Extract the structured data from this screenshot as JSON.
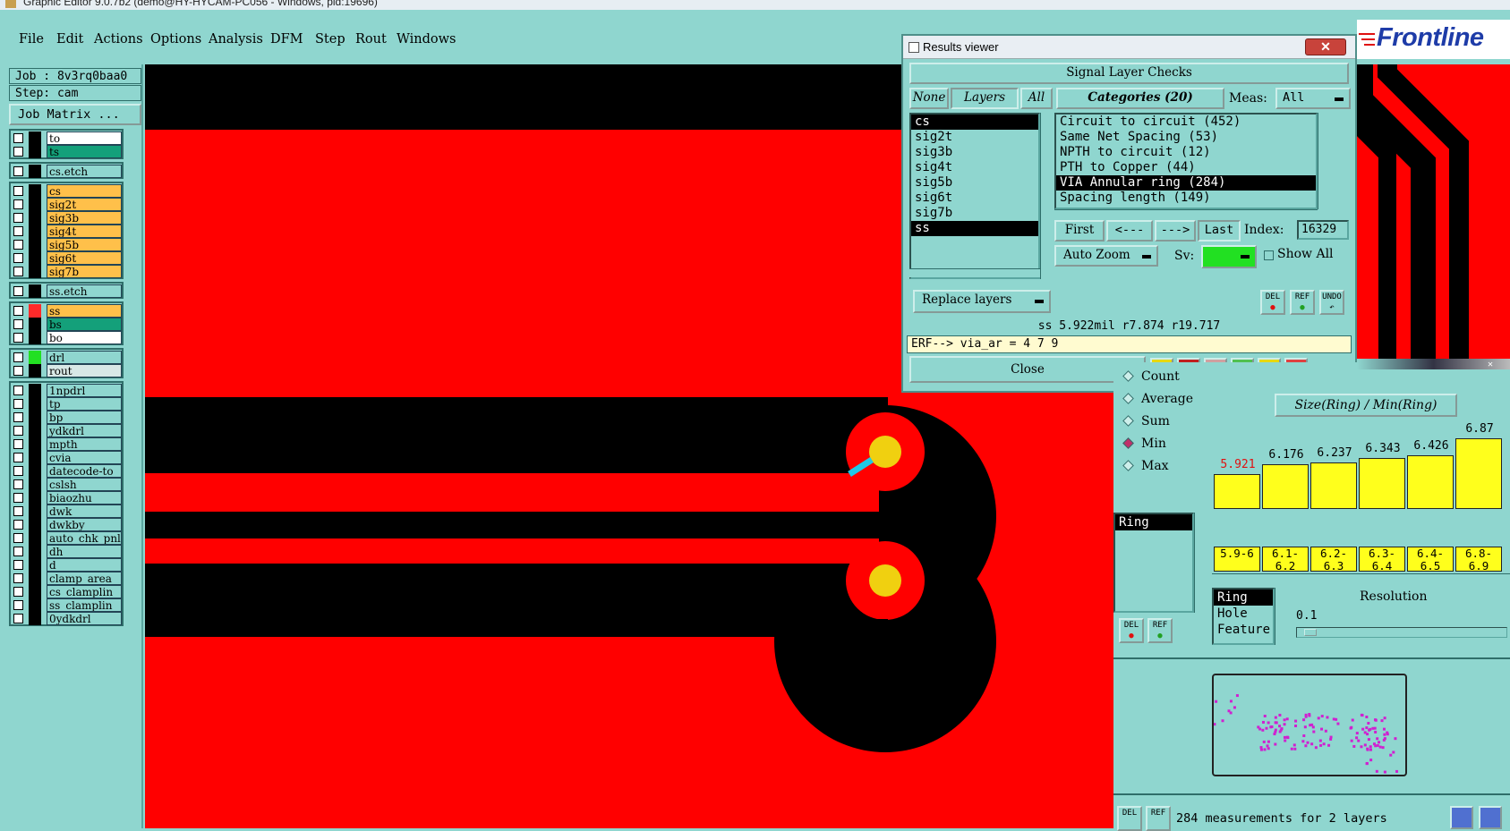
{
  "window_title": "Graphic Editor 9.0.7b2 (demo@HY-HYCAM-PC056 - Windows, pid:19696)",
  "menu": [
    "File",
    "Edit",
    "Actions",
    "Options",
    "Analysis",
    "DFM",
    "Step",
    "Rout",
    "Windows"
  ],
  "job_label": "Job : 8v3rq0baa0",
  "step_label": "Step: cam",
  "job_matrix_label": "Job Matrix ...",
  "layer_groups": [
    [
      {
        "name": "to",
        "bg": "#ffffff"
      },
      {
        "name": "ts",
        "bg": "#14a07a"
      }
    ],
    [
      {
        "name": "cs.etch",
        "bg": "#8fd6cf"
      }
    ],
    [
      {
        "name": "cs",
        "bg": "#ffc04a"
      },
      {
        "name": "sig2t",
        "bg": "#ffc04a"
      },
      {
        "name": "sig3b",
        "bg": "#ffc04a"
      },
      {
        "name": "sig4t",
        "bg": "#ffc04a"
      },
      {
        "name": "sig5b",
        "bg": "#ffc04a"
      },
      {
        "name": "sig6t",
        "bg": "#ffc04a"
      },
      {
        "name": "sig7b",
        "bg": "#ffc04a"
      }
    ],
    [
      {
        "name": "ss.etch",
        "bg": "#8fd6cf"
      }
    ],
    [
      {
        "name": "ss",
        "bg": "#ffc04a",
        "swatch": "#ff2a2a"
      },
      {
        "name": "bs",
        "bg": "#14a07a"
      },
      {
        "name": "bo",
        "bg": "#ffffff"
      }
    ],
    [
      {
        "name": "drl",
        "bg": "#8fd6cf",
        "swatch": "#22e022"
      },
      {
        "name": "rout",
        "bg": "#d8e8e6"
      }
    ],
    [
      {
        "name": "1npdrl",
        "bg": "#8fd6cf"
      },
      {
        "name": "tp",
        "bg": "#8fd6cf"
      },
      {
        "name": "bp",
        "bg": "#8fd6cf"
      },
      {
        "name": "ydkdrl",
        "bg": "#8fd6cf"
      },
      {
        "name": "mpth",
        "bg": "#8fd6cf"
      },
      {
        "name": "cvia",
        "bg": "#8fd6cf"
      },
      {
        "name": "datecode-to",
        "bg": "#8fd6cf"
      },
      {
        "name": "cslsh",
        "bg": "#8fd6cf"
      },
      {
        "name": "biaozhu",
        "bg": "#8fd6cf"
      },
      {
        "name": "dwk",
        "bg": "#8fd6cf"
      },
      {
        "name": "dwkby",
        "bg": "#8fd6cf"
      },
      {
        "name": "auto_chk_pnl",
        "bg": "#8fd6cf"
      },
      {
        "name": "dh",
        "bg": "#8fd6cf"
      },
      {
        "name": "d",
        "bg": "#8fd6cf"
      },
      {
        "name": "clamp_area",
        "bg": "#8fd6cf"
      },
      {
        "name": "cs_clamplin",
        "bg": "#8fd6cf"
      },
      {
        "name": "ss_clamplin",
        "bg": "#8fd6cf"
      },
      {
        "name": "0ydkdrl",
        "bg": "#8fd6cf"
      }
    ]
  ],
  "brand": "Frontline",
  "results_viewer": {
    "title": "Results viewer",
    "close_x": "✕",
    "header": "Signal Layer Checks",
    "none_btn": "None",
    "layers_btn": "Layers",
    "all_btn": "All",
    "categories_btn": "Categories (20)",
    "meas_label": "Meas:",
    "meas_value": "All",
    "layers": [
      "cs",
      "sig2t",
      "sig3b",
      "sig4t",
      "sig5b",
      "sig6t",
      "sig7b",
      "ss"
    ],
    "categories": [
      "Circuit to circuit (452)",
      "Same Net Spacing (53)",
      "NPTH to circuit (12)",
      "PTH to Copper (44)",
      "VIA Annular ring (284)",
      "Spacing length (149)"
    ],
    "first_btn": "First",
    "prev_btn": "<---",
    "next_btn": "--->",
    "last_btn": "Last",
    "index_label": "Index:",
    "index_value": "16329",
    "auto_zoom_btn": "Auto Zoom",
    "sv_label": "Sv:",
    "show_all_label": "Show All",
    "replace_layers_btn": "Replace layers",
    "del_btn": "DEL",
    "ref_btn": "REF",
    "undo_btn": "UNDO",
    "status_line": "ss 5.922mil  r7.874  r19.717",
    "erf_line": "ERF--> via_ar = 4 7 9",
    "close_btn": "Close"
  },
  "histogram": {
    "title": "Size(Ring) / Min(Ring)",
    "stats": [
      "Count",
      "Average",
      "Sum",
      "Min",
      "Max"
    ],
    "selected_stat": "Min",
    "measure_list": [
      "Ring"
    ],
    "chart_data": {
      "type": "bar",
      "categories": [
        "5.9-6",
        "6.1-6.2",
        "6.2-6.3",
        "6.3-6.4",
        "6.4-6.5",
        "6.8-6.9"
      ],
      "values": [
        5.921,
        6.176,
        6.237,
        6.343,
        6.426,
        6.87
      ],
      "value_labels": [
        "5.921",
        "6.176",
        "6.237",
        "6.343",
        "6.426",
        "6.87"
      ],
      "highlight_color": "#e01010",
      "bar_color": "#ffff1c"
    },
    "resolution_list": [
      "Ring",
      "Hole",
      "Feature"
    ],
    "resolution_label": "Resolution",
    "resolution_value": "0.1",
    "del_btn": "DEL",
    "ref_btn": "REF"
  },
  "footer_status": "284 measurements for 2 layers"
}
